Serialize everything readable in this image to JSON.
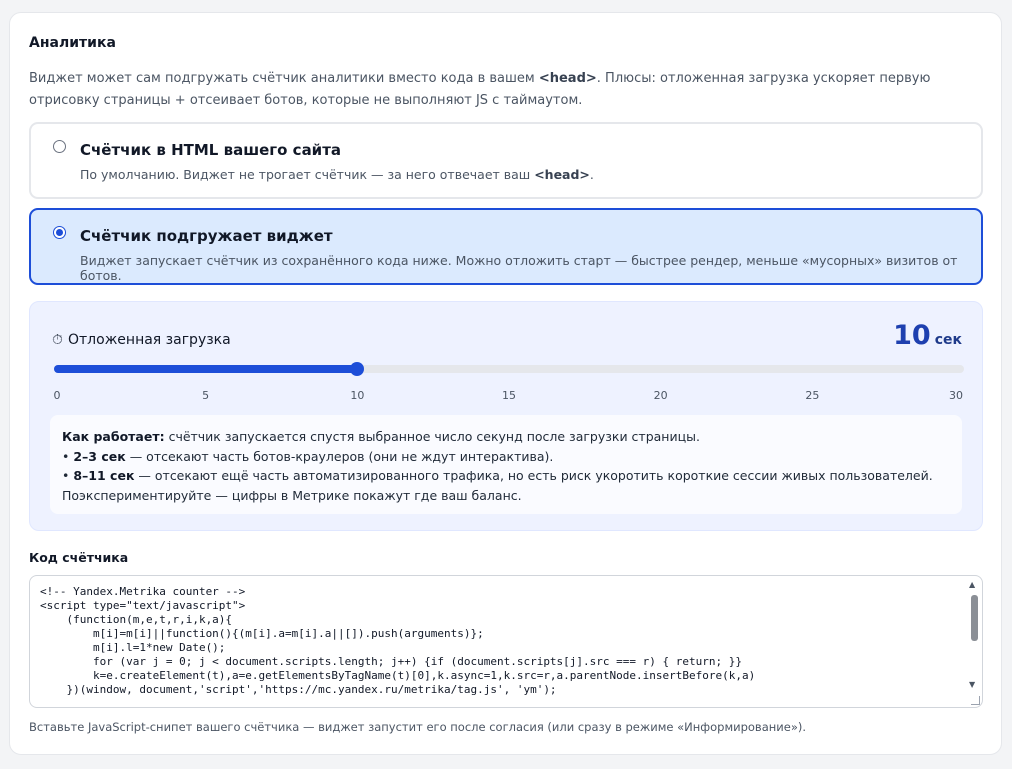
{
  "analytics": {
    "title": "Аналитика",
    "desc_before": "Виджет может сам подгружать счётчик аналитики вместо кода в вашем ",
    "desc_code": "<head>",
    "desc_after": ". Плюсы: отложенная загрузка ускоряет первую отрисовку страницы + отсеивает ботов, которые не выполняют JS с таймаутом."
  },
  "options": [
    {
      "title": "Счётчик в HTML вашего сайта",
      "desc_before": "По умолчанию. Виджет не трогает счётчик — за него отвечает ваш ",
      "desc_code": "<head>",
      "desc_after": ".",
      "selected": false
    },
    {
      "title": "Счётчик подгружает виджет",
      "desc": "Виджет запускает счётчик из сохранённого кода ниже. Можно отложить старт — быстрее рендер, меньше «мусорных» визитов от ботов.",
      "selected": true
    }
  ],
  "delay": {
    "icon": "timer-icon",
    "icon_glyph": "⏱",
    "label": "Отложенная загрузка",
    "value": "10",
    "unit": "сек",
    "slider": {
      "min": 0,
      "max": 30,
      "value": 10
    },
    "ticks": [
      "0",
      "5",
      "10",
      "15",
      "20",
      "25",
      "30"
    ],
    "howto": {
      "lead": "Как работает:",
      "lead_text": " счётчик запускается спустя выбранное число секунд после загрузки страницы.",
      "b1_bullet": "• ",
      "b1_strong": "2–3 сек",
      "b1_text": " — отсекают часть ботов-краулеров (они не ждут интерактива).",
      "b2_bullet": "• ",
      "b2_strong": "8–11 сек",
      "b2_text": " — отсекают ещё часть автоматизированного трафика, но есть риск укоротить короткие сессии живых пользователей.",
      "footer": "Поэкспериментируйте — цифры в Метрике покажут где ваш баланс."
    }
  },
  "code": {
    "label": "Код счётчика",
    "value": "<!-- Yandex.Metrika counter -->\n<script type=\"text/javascript\">\n    (function(m,e,t,r,i,k,a){\n        m[i]=m[i]||function(){(m[i].a=m[i].a||[]).push(arguments)};\n        m[i].l=1*new Date();\n        for (var j = 0; j < document.scripts.length; j++) {if (document.scripts[j].src === r) { return; }}\n        k=e.createElement(t),a=e.getElementsByTagName(t)[0],k.async=1,k.src=r,a.parentNode.insertBefore(k,a)\n    })(window, document,'script','https://mc.yandex.ru/metrika/tag.js', 'ym');",
    "hint": "Вставьте JavaScript-снипет вашего счётчика — виджет запустит его после согласия (или сразу в режиме «Информирование»)."
  },
  "colors": {
    "accent": "#1d4ed8",
    "selected_bg": "#dbeafe",
    "panel_bg": "#eef2ff"
  }
}
